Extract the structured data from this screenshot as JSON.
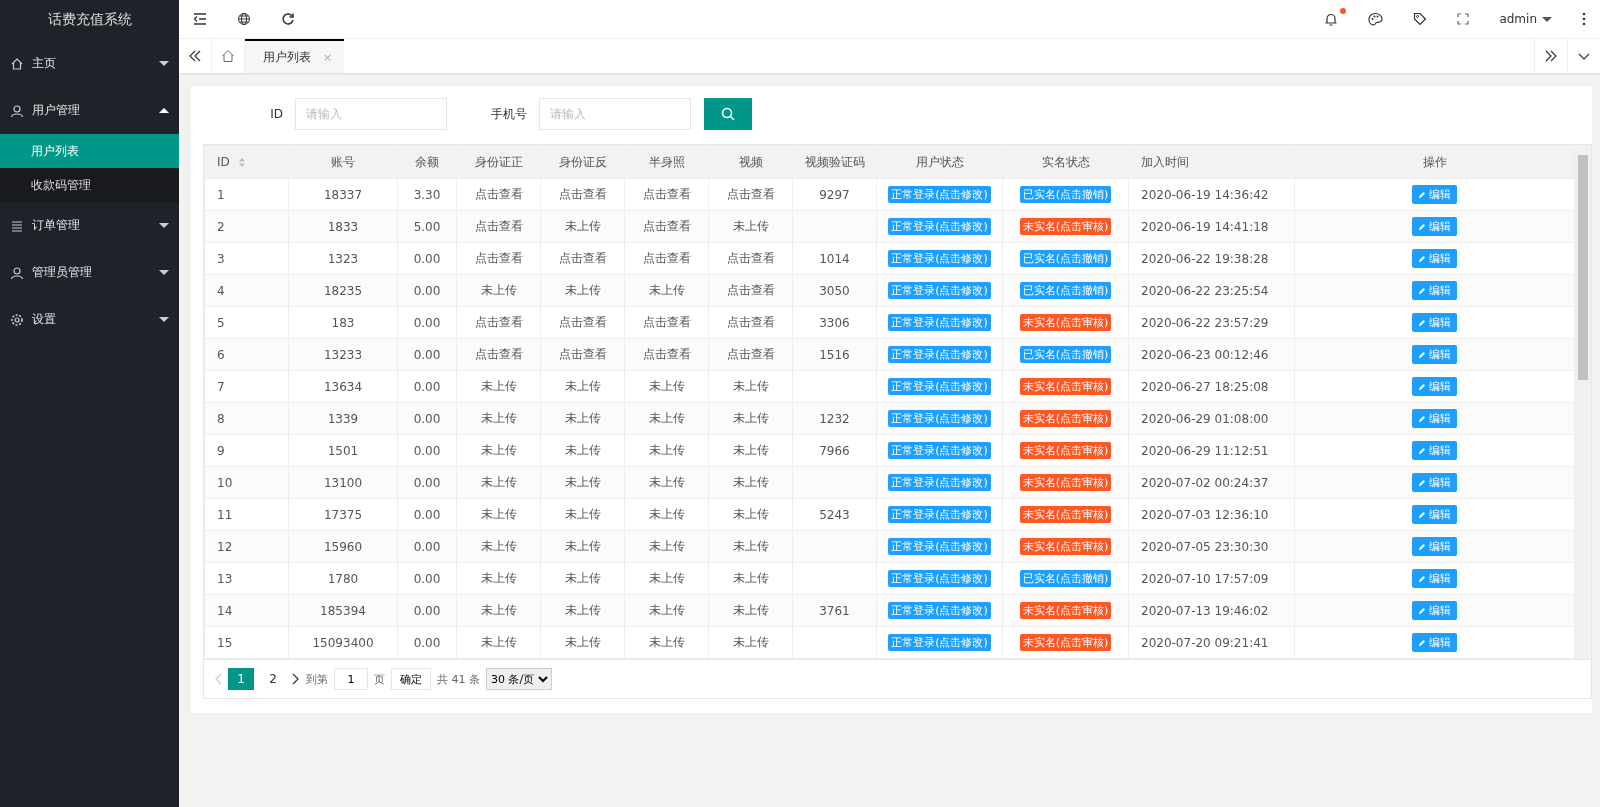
{
  "sidebar": {
    "title": "话费充值系统",
    "items": [
      {
        "label": "主页",
        "expanded": false
      },
      {
        "label": "用户管理",
        "expanded": true,
        "children": [
          {
            "label": "用户列表",
            "selected": true
          },
          {
            "label": "收款码管理",
            "selected": false
          }
        ]
      },
      {
        "label": "订单管理",
        "expanded": false
      },
      {
        "label": "管理员管理",
        "expanded": false
      },
      {
        "label": "设置",
        "expanded": false
      }
    ]
  },
  "header": {
    "user": "admin",
    "notification_dot": true
  },
  "tabs": [
    {
      "label": "用户列表",
      "close": "×",
      "selected": true
    }
  ],
  "search": {
    "fields": [
      {
        "label": "ID",
        "placeholder": "请输入"
      },
      {
        "label": "手机号",
        "placeholder": "请输入"
      }
    ]
  },
  "table": {
    "columns": [
      "ID",
      "账号",
      "余额",
      "身份证正",
      "身份证反",
      "半身照",
      "视频",
      "视频验证码",
      "用户状态",
      "实名状态",
      "加入时间",
      "操作"
    ],
    "rows": [
      {
        "id": "1",
        "account": "18337",
        "balance": "3.30",
        "id_front": "点击查看",
        "id_back": "点击查看",
        "half_body": "点击查看",
        "video": "点击查看",
        "video_code": "9297",
        "user_status": "正常登录(点击修改)",
        "verified": true,
        "realname_status": "已实名(点击撤销)",
        "joined": "2020-06-19 14:36:42",
        "action": "编辑"
      },
      {
        "id": "2",
        "account": "1833",
        "balance": "5.00",
        "id_front": "点击查看",
        "id_back": "未上传",
        "half_body": "点击查看",
        "video": "未上传",
        "user_status": "正常登录(点击修改)",
        "verified": false,
        "realname_status": "未实名(点击审核)",
        "joined": "2020-06-19 14:41:18",
        "action": "编辑"
      },
      {
        "id": "3",
        "account": "1323",
        "balance": "0.00",
        "id_front": "点击查看",
        "id_back": "点击查看",
        "half_body": "点击查看",
        "video": "点击查看",
        "video_code": "1014",
        "user_status": "正常登录(点击修改)",
        "verified": true,
        "realname_status": "已实名(点击撤销)",
        "joined": "2020-06-22 19:38:28",
        "action": "编辑"
      },
      {
        "id": "4",
        "account": "18235",
        "balance": "0.00",
        "id_front": "未上传",
        "id_back": "未上传",
        "half_body": "未上传",
        "video": "点击查看",
        "video_code": "3050",
        "user_status": "正常登录(点击修改)",
        "verified": true,
        "realname_status": "已实名(点击撤销)",
        "joined": "2020-06-22 23:25:54",
        "action": "编辑"
      },
      {
        "id": "5",
        "account": "183",
        "balance": "0.00",
        "id_front": "点击查看",
        "id_back": "点击查看",
        "half_body": "点击查看",
        "video": "点击查看",
        "video_code": "3306",
        "user_status": "正常登录(点击修改)",
        "verified": false,
        "realname_status": "未实名(点击审核)",
        "joined": "2020-06-22 23:57:29",
        "action": "编辑"
      },
      {
        "id": "6",
        "account": "13233",
        "balance": "0.00",
        "id_front": "点击查看",
        "id_back": "点击查看",
        "half_body": "点击查看",
        "video": "点击查看",
        "video_code": "1516",
        "user_status": "正常登录(点击修改)",
        "verified": true,
        "realname_status": "已实名(点击撤销)",
        "joined": "2020-06-23 00:12:46",
        "action": "编辑"
      },
      {
        "id": "7",
        "account": "13634",
        "balance": "0.00",
        "id_front": "未上传",
        "id_back": "未上传",
        "half_body": "未上传",
        "video": "未上传",
        "user_status": "正常登录(点击修改)",
        "verified": false,
        "realname_status": "未实名(点击审核)",
        "joined": "2020-06-27 18:25:08",
        "action": "编辑"
      },
      {
        "id": "8",
        "account": "1339",
        "balance": "0.00",
        "id_front": "未上传",
        "id_back": "未上传",
        "half_body": "未上传",
        "video": "未上传",
        "video_code": "1232",
        "user_status": "正常登录(点击修改)",
        "verified": false,
        "realname_status": "未实名(点击审核)",
        "joined": "2020-06-29 01:08:00",
        "action": "编辑"
      },
      {
        "id": "9",
        "account": "1501",
        "balance": "0.00",
        "id_front": "未上传",
        "id_back": "未上传",
        "half_body": "未上传",
        "video": "未上传",
        "video_code": "7966",
        "user_status": "正常登录(点击修改)",
        "verified": false,
        "realname_status": "未实名(点击审核)",
        "joined": "2020-06-29 11:12:51",
        "action": "编辑"
      },
      {
        "id": "10",
        "account": "13100",
        "balance": "0.00",
        "id_front": "未上传",
        "id_back": "未上传",
        "half_body": "未上传",
        "video": "未上传",
        "user_status": "正常登录(点击修改)",
        "verified": false,
        "realname_status": "未实名(点击审核)",
        "joined": "2020-07-02 00:24:37",
        "action": "编辑"
      },
      {
        "id": "11",
        "account": "17375",
        "balance": "0.00",
        "id_front": "未上传",
        "id_back": "未上传",
        "half_body": "未上传",
        "video": "未上传",
        "video_code": "5243",
        "user_status": "正常登录(点击修改)",
        "verified": false,
        "realname_status": "未实名(点击审核)",
        "joined": "2020-07-03 12:36:10",
        "action": "编辑"
      },
      {
        "id": "12",
        "account": "15960",
        "balance": "0.00",
        "id_front": "未上传",
        "id_back": "未上传",
        "half_body": "未上传",
        "video": "未上传",
        "user_status": "正常登录(点击修改)",
        "verified": false,
        "realname_status": "未实名(点击审核)",
        "joined": "2020-07-05 23:30:30",
        "action": "编辑"
      },
      {
        "id": "13",
        "account": "1780",
        "balance": "0.00",
        "id_front": "未上传",
        "id_back": "未上传",
        "half_body": "未上传",
        "video": "未上传",
        "user_status": "正常登录(点击修改)",
        "verified": true,
        "realname_status": "已实名(点击撤销)",
        "joined": "2020-07-10 17:57:09",
        "action": "编辑"
      },
      {
        "id": "14",
        "account": "185394",
        "balance": "0.00",
        "id_front": "未上传",
        "id_back": "未上传",
        "half_body": "未上传",
        "video": "未上传",
        "video_code": "3761",
        "user_status": "正常登录(点击修改)",
        "verified": false,
        "realname_status": "未实名(点击审核)",
        "joined": "2020-07-13 19:46:02",
        "action": "编辑"
      },
      {
        "id": "15",
        "account": "15093400",
        "balance": "0.00",
        "id_front": "未上传",
        "id_back": "未上传",
        "half_body": "未上传",
        "video": "未上传",
        "user_status": "正常登录(点击修改)",
        "verified": false,
        "realname_status": "未实名(点击审核)",
        "joined": "2020-07-20 09:21:41",
        "action": "编辑"
      }
    ]
  },
  "pagination": {
    "pages": [
      {
        "label": "1",
        "selected": true
      },
      {
        "label": "2",
        "selected": false
      }
    ],
    "goto_label": "到第",
    "goto_value": "1",
    "page_unit": "页",
    "confirm": "确定",
    "total": "共 41 条",
    "page_size": "30 条/页"
  }
}
